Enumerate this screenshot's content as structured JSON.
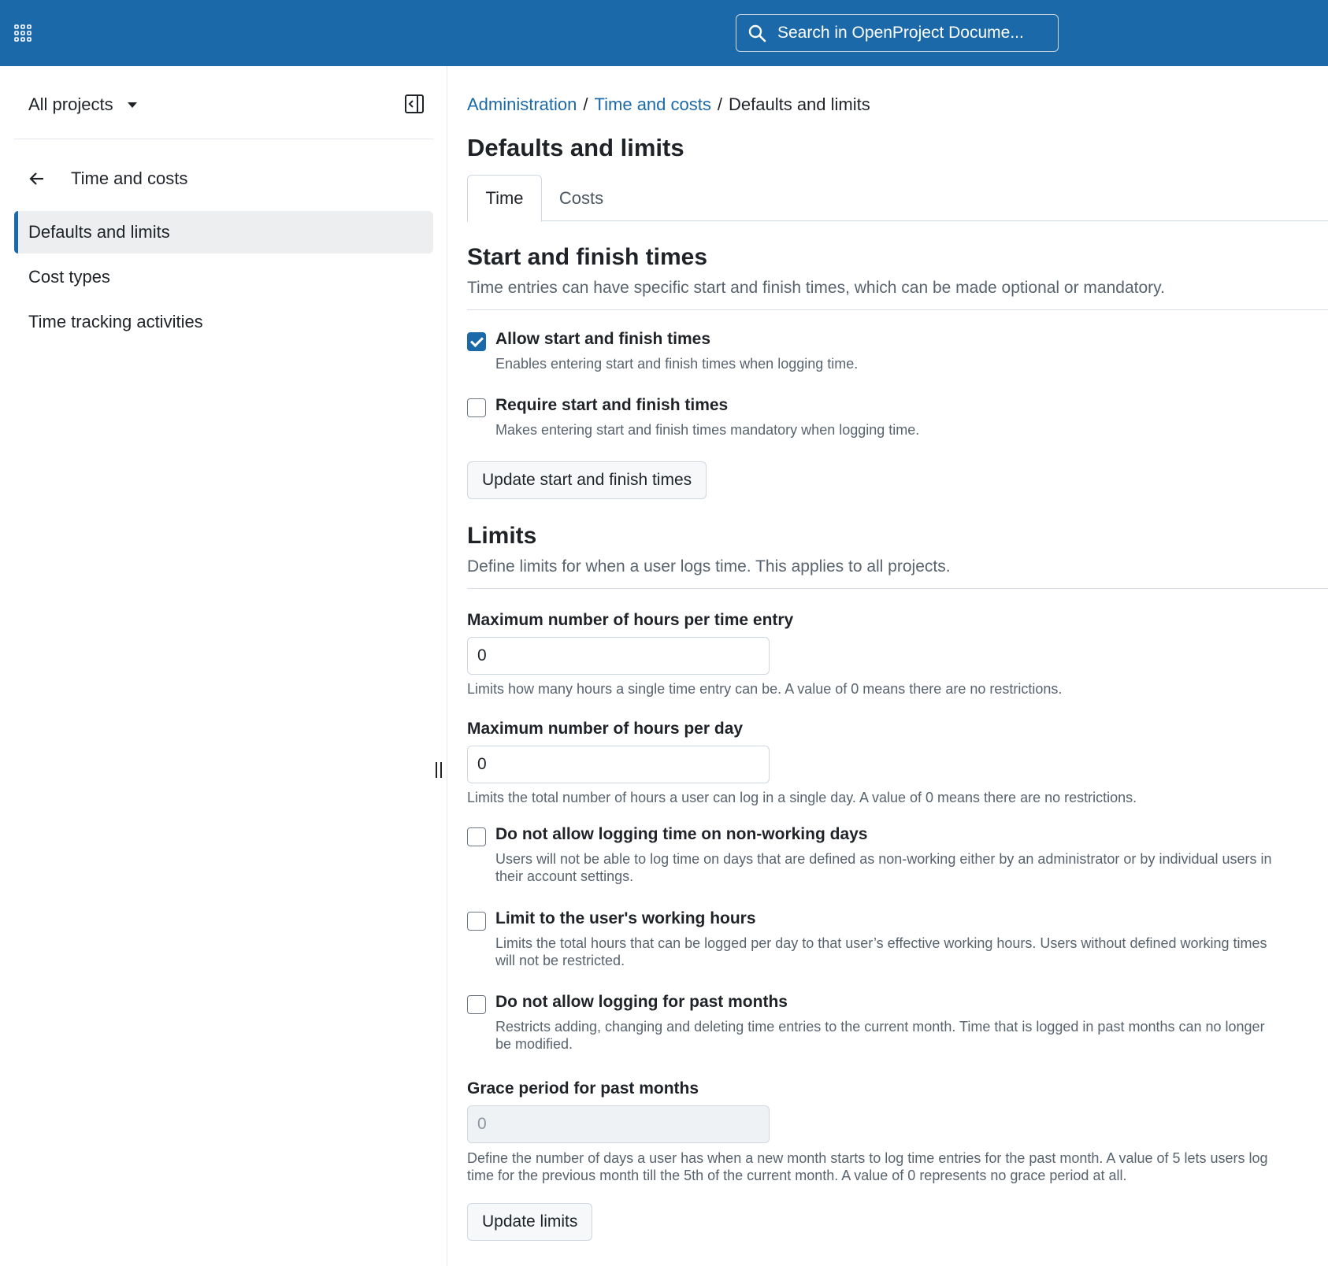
{
  "header": {
    "search_placeholder": "Search in OpenProject Docume..."
  },
  "colors": {
    "brand": "#1b69a8"
  },
  "sidebar": {
    "project_selector": "All projects",
    "back_label": "Time and costs",
    "items": [
      {
        "label": "Defaults and limits",
        "active": true
      },
      {
        "label": "Cost types",
        "active": false
      },
      {
        "label": "Time tracking activities",
        "active": false
      }
    ]
  },
  "breadcrumb": {
    "items": [
      "Administration",
      "Time and costs"
    ],
    "separator": "/",
    "current": "Defaults and limits"
  },
  "page": {
    "title": "Defaults and limits",
    "tabs": [
      {
        "label": "Time",
        "active": true
      },
      {
        "label": "Costs",
        "active": false
      }
    ]
  },
  "start_finish": {
    "title": "Start and finish times",
    "description": "Time entries can have specific start and finish times, which can be made optional or mandatory.",
    "allow": {
      "label": "Allow start and finish times",
      "help": "Enables entering start and finish times when logging time.",
      "checked": true
    },
    "require": {
      "label": "Require start and finish times",
      "help": "Makes entering start and finish times mandatory when logging time.",
      "checked": false
    },
    "button": "Update start and finish times"
  },
  "limits": {
    "title": "Limits",
    "description": "Define limits for when a user logs time. This applies to all projects.",
    "max_per_entry": {
      "label": "Maximum number of hours per time entry",
      "value": "0",
      "help": "Limits how many hours a single time entry can be. A value of 0 means there are no restrictions."
    },
    "max_per_day": {
      "label": "Maximum number of hours per day",
      "value": "0",
      "help": "Limits the total number of hours a user can log in a single day. A value of 0 means there are no restrictions."
    },
    "non_working_days": {
      "label": "Do not allow logging time on non-working days",
      "help": "Users will not be able to log time on days that are defined as non-working either by an administrator or by individual users in their account settings.",
      "checked": false
    },
    "working_hours": {
      "label": "Limit to the user's working hours",
      "help": "Limits the total hours that can be logged per day to that user’s effective working hours. Users without defined working times will not be restricted.",
      "checked": false
    },
    "past_months": {
      "label": "Do not allow logging for past months",
      "help": "Restricts adding, changing and deleting time entries to the current month. Time that is logged in past months can no longer be modified.",
      "checked": false
    },
    "grace_period": {
      "label": "Grace period for past months",
      "value": "0",
      "help": "Define the number of days a user has when a new month starts to log time entries for the past month. A value of 5 lets users log time for the previous month till the 5th of the current month. A value of 0 represents no grace period at all."
    },
    "button": "Update limits"
  }
}
